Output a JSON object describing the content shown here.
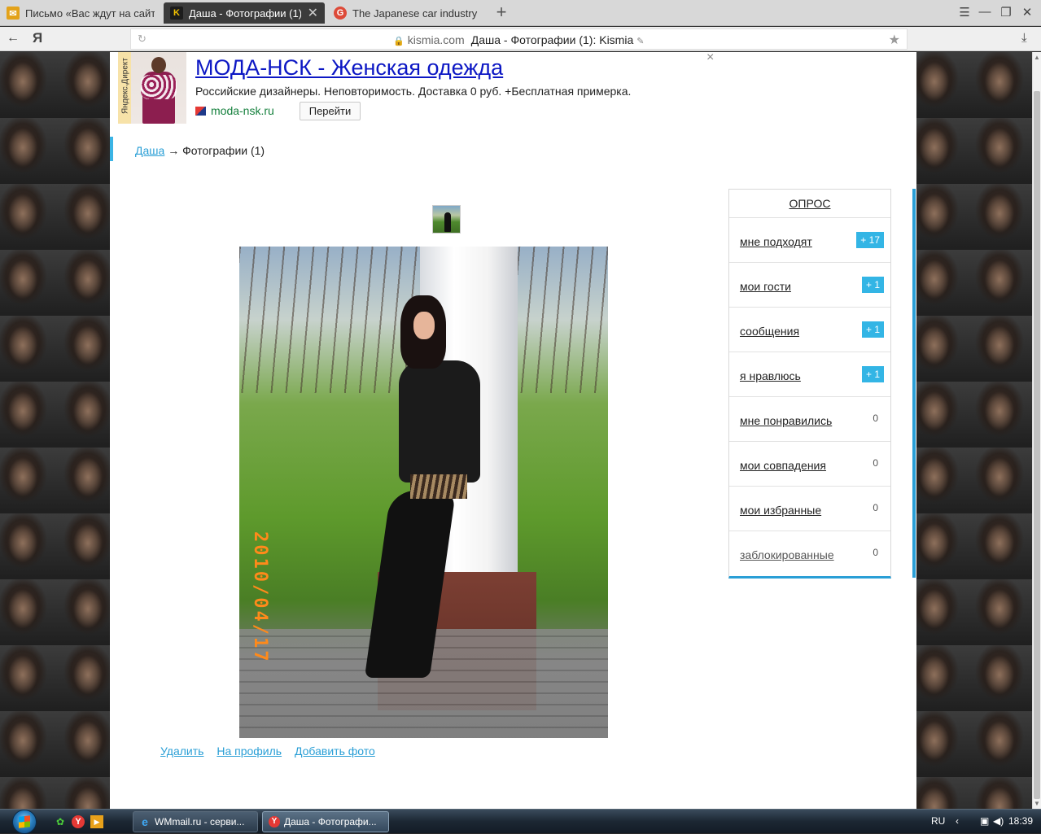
{
  "browser": {
    "tabs": [
      {
        "title": "Письмо «Вас ждут на сайте",
        "icon": "mail-icon",
        "active": false
      },
      {
        "title": "Даша - Фотографии (1):",
        "icon": "kismia-icon",
        "active": true
      },
      {
        "title": "The Japanese car industry -",
        "icon": "google-plus-icon",
        "active": false
      }
    ],
    "new_tab": "+",
    "back": "←",
    "yandex": "Я",
    "reload": "↻",
    "domain": "kismia.com",
    "page_title": "Даша - Фотографии (1): Kismia",
    "menu_glyph": "☰",
    "minimize_glyph": "—",
    "restore_glyph": "❐",
    "close_glyph": "✕",
    "star_glyph": "★",
    "download_glyph": "⤓"
  },
  "ad": {
    "vertical_label": "Яндекс.Директ",
    "title": "МОДА-НСК - Женская одежда",
    "text": "Российские дизайнеры. Неповторимость. Доставка 0 руб. +Бесплатная примерка.",
    "domain": "moda-nsk.ru",
    "button": "Перейти",
    "close": "×"
  },
  "breadcrumb": {
    "link": "Даша",
    "separator": "→",
    "current": "Фотографии (1)"
  },
  "photo": {
    "date_stamp": "2010/04/17"
  },
  "photo_actions": {
    "delete": "Удалить",
    "to_profile": "На профиль",
    "add_photo": "Добавить фото"
  },
  "sidebar": {
    "title": "ОПРОС",
    "items": [
      {
        "label": "мне подходят",
        "badge": "+ 17"
      },
      {
        "label": "мои гости",
        "badge": "+ 1"
      },
      {
        "label": "сообщения",
        "badge": "+ 1"
      },
      {
        "label": "я нравлюсь",
        "badge": "+ 1"
      },
      {
        "label": "мне понравились",
        "count": "0"
      },
      {
        "label": "мои совпадения",
        "count": "0"
      },
      {
        "label": "мои избранные",
        "count": "0"
      },
      {
        "label": "заблокированные",
        "count": "0"
      }
    ]
  },
  "taskbar": {
    "tasks": [
      {
        "title": "WMmail.ru - серви...",
        "icon": "ie-icon"
      },
      {
        "title": "Даша - Фотографи...",
        "icon": "yandex-browser-icon"
      }
    ],
    "language": "RU",
    "time": "18:39"
  },
  "colors": {
    "accent": "#2a9fd6",
    "badge": "#33b5e5",
    "ad_link": "#0c17c4",
    "ad_domain": "#15803d"
  }
}
